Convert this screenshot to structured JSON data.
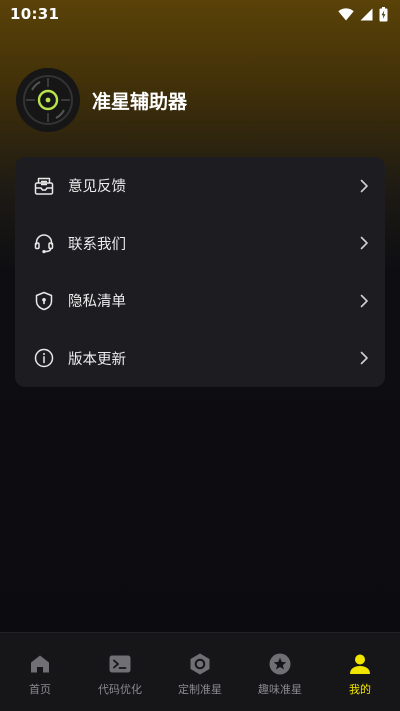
{
  "status_bar": {
    "time": "10:31"
  },
  "profile": {
    "app_name": "准星辅助器"
  },
  "menu": {
    "items": [
      {
        "label": "意见反馈",
        "icon": "feedback-mailbox-icon"
      },
      {
        "label": "联系我们",
        "icon": "headset-icon"
      },
      {
        "label": "隐私清单",
        "icon": "shield-lock-icon"
      },
      {
        "label": "版本更新",
        "icon": "info-icon"
      }
    ]
  },
  "tabs": [
    {
      "label": "首页",
      "icon": "home-icon",
      "active": false
    },
    {
      "label": "代码优化",
      "icon": "terminal-icon",
      "active": false
    },
    {
      "label": "定制准星",
      "icon": "hexagon-icon",
      "active": false
    },
    {
      "label": "趣味准星",
      "icon": "star-icon",
      "active": false
    },
    {
      "label": "我的",
      "icon": "user-icon",
      "active": true
    }
  ],
  "colors": {
    "accent": "#f2e600",
    "inactive": "#8a8a8f",
    "card": "#1d1d21",
    "header_gold": "#5a4208"
  }
}
